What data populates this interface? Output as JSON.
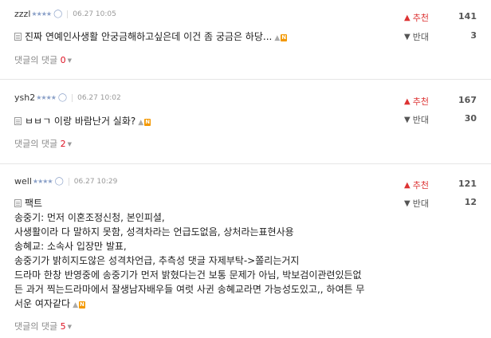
{
  "comments": [
    {
      "user": "zzzl",
      "stars": "★★★★",
      "time": "06.27 10:05",
      "text": "진짜 연예인사생활 안궁금해하고싶은데 이건 좀 궁금은 하당...",
      "replies_label": "댓글의 댓글",
      "replies_count": "0",
      "up_label": "추천",
      "up_count": "141",
      "down_label": "반대",
      "down_count": "3"
    },
    {
      "user": "ysh2",
      "stars": "★★★★",
      "time": "06.27 10:02",
      "text": "ㅂㅂㄱ 이랑 바람난거 실화?",
      "replies_label": "댓글의 댓글",
      "replies_count": "2",
      "up_label": "추천",
      "up_count": "167",
      "down_label": "반대",
      "down_count": "30"
    },
    {
      "user": "well",
      "stars": "★★★★",
      "time": "06.27 10:29",
      "lines": [
        "팩트",
        "송중기: 먼저 이혼조정신청, 본인피셜,",
        "사생활이라 다 말하지 못함, 성격차라는 언급도없음, 상처라는표현사용",
        "송혜교: 소속사 입장만 발표,",
        "송중기가 밝히지도않은 성격차언급, 추측성 댓글 자제부탁->쫄리는거지",
        "드라마 한창 반영중에 송중기가 먼저 밝혔다는건 보통 문제가 아님, 박보검이관련있든없",
        "든 과거 찍는드라마에서 잘생남자배우들 여럿 사귄 송혜교라면 가능성도있고,, 하여튼 무",
        "서운 여자같다"
      ],
      "replies_label": "댓글의 댓글",
      "replies_count": "5",
      "up_label": "추천",
      "up_count": "121",
      "down_label": "반대",
      "down_count": "12"
    }
  ],
  "icons": {
    "person": "person-icon",
    "doc": "document-icon",
    "lock": "lock-icon",
    "new": "new-badge",
    "up": "thumbs-up-icon",
    "down": "thumbs-down-icon"
  },
  "new_badge": "N",
  "colors": {
    "up": "#dd3333",
    "reply_count": "#dd1122",
    "new_badge": "#f39800"
  }
}
